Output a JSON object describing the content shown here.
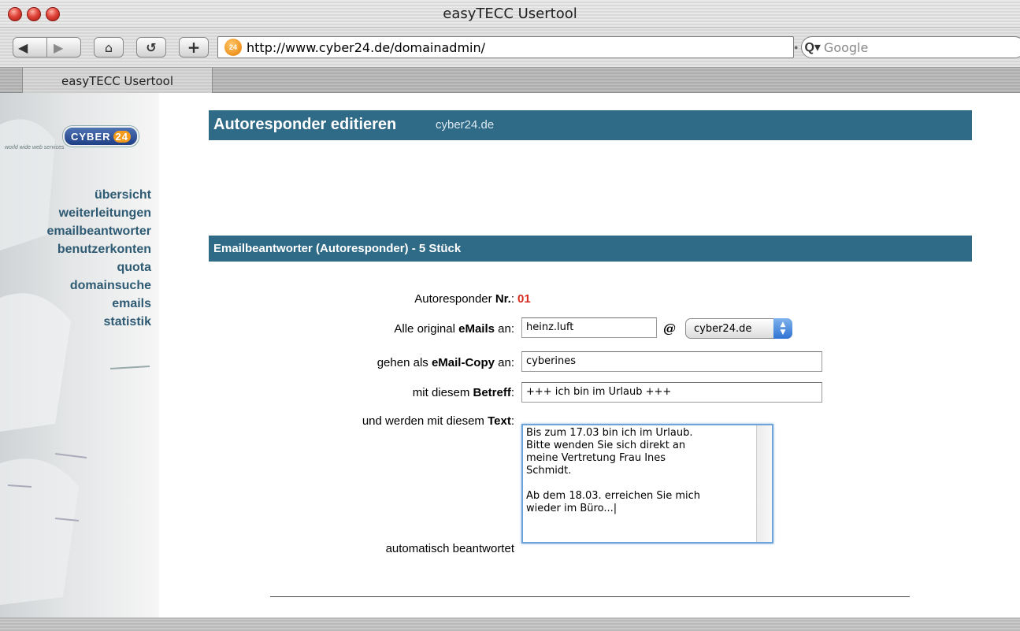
{
  "window": {
    "title": "easyTECC Usertool"
  },
  "toolbar": {
    "back_label": "◀",
    "forward_label": "▶",
    "home_label": "⌂",
    "reload_label": "↺",
    "add_label": "+",
    "url": "http://www.cyber24.de/domainadmin/",
    "favicon_text": "24",
    "search_placeholder": "Google",
    "search_icon": "Q▾"
  },
  "tabs": [
    {
      "label": "easyTECC Usertool"
    }
  ],
  "sidebar": {
    "logo_text": "CYBER",
    "logo_num": "24",
    "logo_tagline": "world wide web services",
    "items": [
      {
        "label": "übersicht"
      },
      {
        "label": "weiterleitungen"
      },
      {
        "label": "emailbeantworter"
      },
      {
        "label": "benutzerkonten"
      },
      {
        "label": "quota"
      },
      {
        "label": "domainsuche"
      },
      {
        "label": "emails"
      },
      {
        "label": "statistik"
      }
    ]
  },
  "header": {
    "title": "Autoresponder editieren",
    "domain": "cyber24.de"
  },
  "section": {
    "title": "Emailbeantworter (Autoresponder) - 5 Stück"
  },
  "form": {
    "nr_label_pre": "Autoresponder ",
    "nr_label_bold": "Nr.",
    "nr_label_post": ":",
    "nr_value": "01",
    "orig_label_pre": "Alle original ",
    "orig_label_bold": "eMails",
    "orig_label_post": " an:",
    "orig_value": "heinz.luft",
    "at_sign": "@",
    "domain_select": "cyber24.de",
    "copy_label_pre": "gehen als ",
    "copy_label_bold": "eMail-Copy",
    "copy_label_post": " an:",
    "copy_value": "cyberines",
    "subject_label_pre": "mit diesem ",
    "subject_label_bold": "Betreff",
    "subject_label_post": ":",
    "subject_value": "+++ ich bin im Urlaub +++",
    "text_label_pre": "und werden mit diesem ",
    "text_label_bold": "Text",
    "text_label_post": ":",
    "text_value": "Bis zum 17.03 bin ich im Urlaub.\nBitte wenden Sie sich direkt an\nmeine Vertretung Frau Ines\nSchmidt.\n\nAb dem 18.03. erreichen Sie mich\nwieder im Büro...|",
    "auto_label": "automatisch beantwortet"
  },
  "colors": {
    "accent": "#2f6a87",
    "nav_text": "#2e5b73",
    "nr_value": "#d62b20"
  }
}
